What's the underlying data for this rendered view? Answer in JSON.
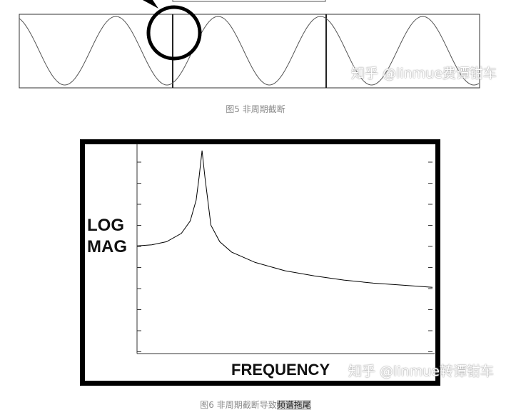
{
  "figure5": {
    "caption": "图5 非周期截断"
  },
  "figure6": {
    "caption_prefix": "图6 非周期截断导致",
    "caption_highlight": "频谱拖尾",
    "ylabel_line1": "LOG",
    "ylabel_line2": "MAG",
    "xlabel": "FREQUENCY"
  },
  "watermark": {
    "text5": "知乎 @linmue费谭钳车",
    "text6": "知乎 @linmue转谭钳车"
  },
  "chart_data": {
    "type": "line",
    "title": "",
    "xlabel": "FREQUENCY",
    "ylabel": "LOG MAG",
    "x": [
      0,
      0.05,
      0.1,
      0.15,
      0.18,
      0.2,
      0.21,
      0.22,
      0.23,
      0.25,
      0.28,
      0.32,
      0.4,
      0.5,
      0.6,
      0.7,
      0.8,
      0.9,
      1.0
    ],
    "series": [
      {
        "values": [
          0.52,
          0.525,
          0.54,
          0.58,
          0.64,
          0.74,
          0.85,
          0.98,
          0.85,
          0.62,
          0.54,
          0.49,
          0.44,
          0.4,
          0.375,
          0.355,
          0.34,
          0.33,
          0.32
        ]
      }
    ],
    "xlim": [
      0,
      1
    ],
    "ylim": [
      0,
      1
    ],
    "grid": false,
    "line_color": "#000000"
  }
}
